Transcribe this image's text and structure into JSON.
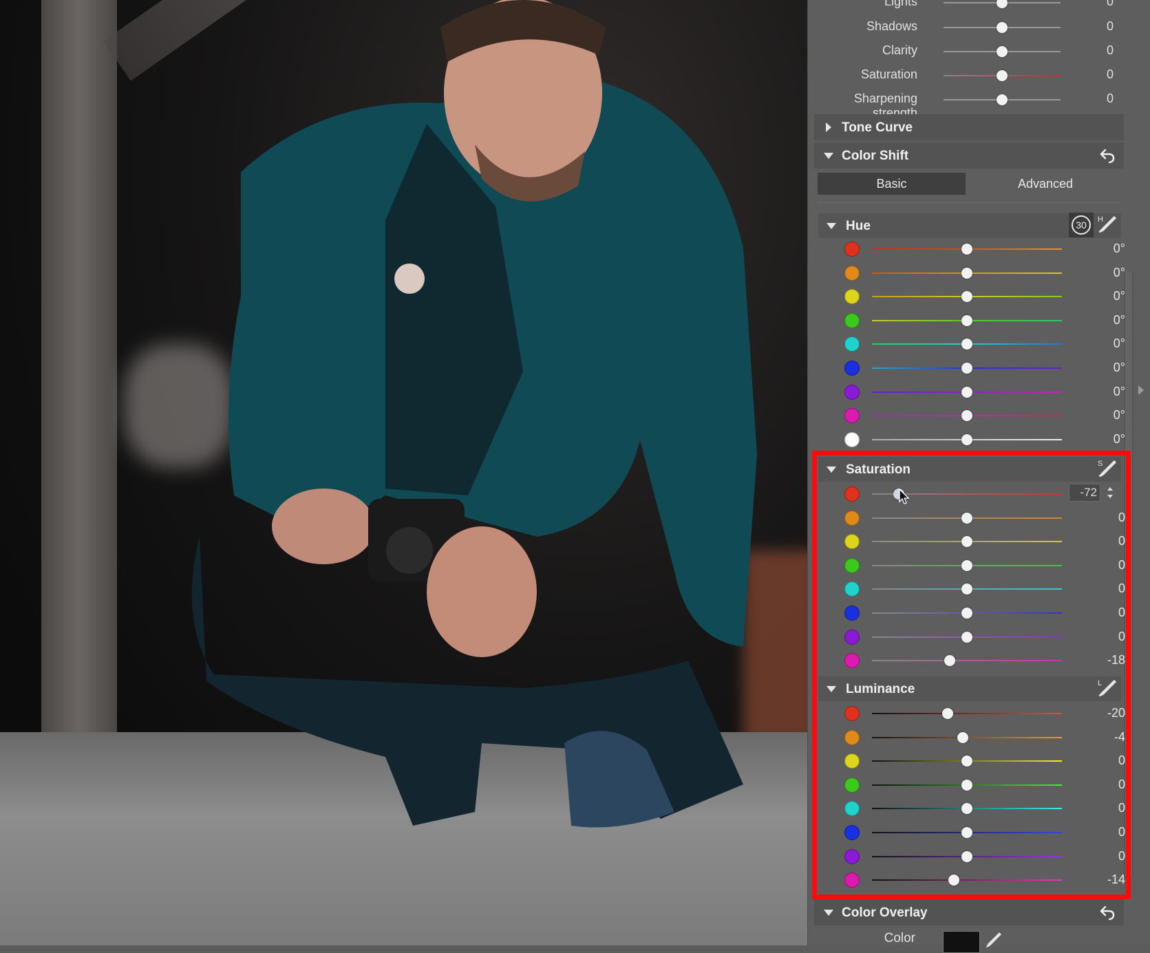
{
  "photo": {
    "alt_subject": "man crouching holding camera"
  },
  "basic_adjustments": [
    {
      "label": "Lights",
      "value": "0"
    },
    {
      "label": "Shadows",
      "value": "0"
    },
    {
      "label": "Clarity",
      "value": "0"
    },
    {
      "label": "Saturation",
      "value": "0"
    },
    {
      "label": "Sharpening strength",
      "value": "0"
    }
  ],
  "sections": {
    "tone_curve": "Tone Curve",
    "color_shift": "Color Shift",
    "color_overlay": "Color Overlay"
  },
  "tabs": {
    "basic": "Basic",
    "advanced": "Advanced"
  },
  "hue": {
    "title": "Hue",
    "badge": "30",
    "picker_letter": "H",
    "rows": [
      {
        "color": "#e0311f",
        "value": "0°",
        "level": 0
      },
      {
        "color": "#e08a1a",
        "value": "0°",
        "level": 0
      },
      {
        "color": "#dcd41d",
        "value": "0°",
        "level": 0
      },
      {
        "color": "#3bc91e",
        "value": "0°",
        "level": 0
      },
      {
        "color": "#1fd3cc",
        "value": "0°",
        "level": 0
      },
      {
        "color": "#1a2fe0",
        "value": "0°",
        "level": 0
      },
      {
        "color": "#8a1ad6",
        "value": "0°",
        "level": 0
      },
      {
        "color": "#dd1ab0",
        "value": "0°",
        "level": 0
      },
      {
        "color": "#ffffff",
        "value": "0°",
        "level": 0
      }
    ]
  },
  "saturation": {
    "title": "Saturation",
    "picker_letter": "S",
    "active_input": "-72",
    "rows": [
      {
        "color": "#e0311f",
        "value": "-72",
        "level": -72
      },
      {
        "color": "#e08a1a",
        "value": "0",
        "level": 0
      },
      {
        "color": "#dcd41d",
        "value": "0",
        "level": 0
      },
      {
        "color": "#3bc91e",
        "value": "0",
        "level": 0
      },
      {
        "color": "#1fd3cc",
        "value": "0",
        "level": 0
      },
      {
        "color": "#1a2fe0",
        "value": "0",
        "level": 0
      },
      {
        "color": "#8a1ad6",
        "value": "0",
        "level": 0
      },
      {
        "color": "#dd1ab0",
        "value": "-18",
        "level": -18
      }
    ]
  },
  "luminance": {
    "title": "Luminance",
    "picker_letter": "L",
    "rows": [
      {
        "color": "#e0311f",
        "value": "-20",
        "level": -20
      },
      {
        "color": "#e08a1a",
        "value": "-4",
        "level": -4
      },
      {
        "color": "#dcd41d",
        "value": "0",
        "level": 0
      },
      {
        "color": "#3bc91e",
        "value": "0",
        "level": 0
      },
      {
        "color": "#1fd3cc",
        "value": "0",
        "level": 0
      },
      {
        "color": "#1a2fe0",
        "value": "0",
        "level": 0
      },
      {
        "color": "#8a1ad6",
        "value": "0",
        "level": 0
      },
      {
        "color": "#dd1ab0",
        "value": "-14",
        "level": -14
      }
    ]
  },
  "color_overlay": {
    "color_label": "Color",
    "color_value": "#111111"
  }
}
